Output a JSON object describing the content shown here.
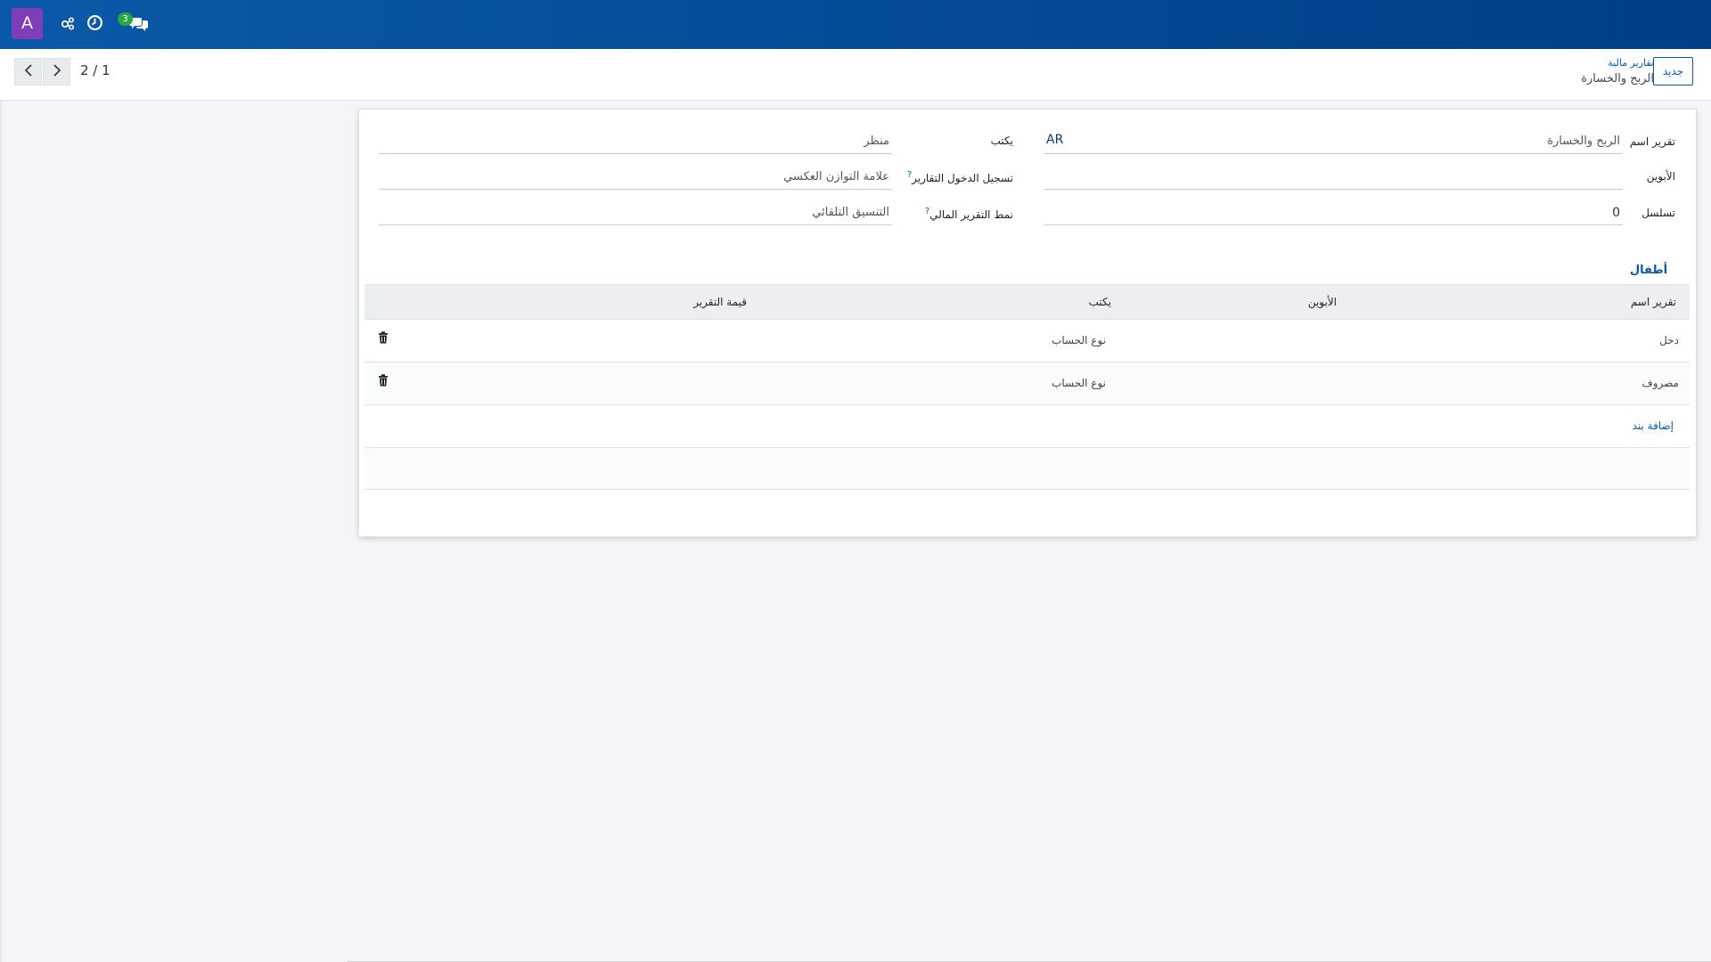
{
  "topbar": {
    "avatar_letter": "A",
    "icons": [
      "settings-share-icon",
      "clock-icon",
      "chat-icon"
    ],
    "chat_badge": "3",
    "bg_colors": [
      "#0a59a8",
      "#003f86"
    ],
    "avatar_color": "#7f3db7",
    "badge_color": "#28a745"
  },
  "control": {
    "pager": "2 / 1",
    "new_button": "جديد",
    "breadcrumb_parent": "تقارير مالية",
    "breadcrumb_current": "الربح والخسارة"
  },
  "form": {
    "report_name_label": "تقرير اسم",
    "report_name_value": "الربح والخسارة",
    "report_name_lang": "AR",
    "parents_label": "الأبوين",
    "parents_value": "",
    "sequence_label": "تسلسل",
    "sequence_value": "0",
    "type_label": "يكتب",
    "type_value": "منظر",
    "report_entry_label": "تسجيل الدخول التقارير",
    "report_entry_help": "?",
    "report_entry_value": "علامة التوازن العكسي",
    "report_style_label": "نمط التقرير المالي",
    "report_style_help": "?",
    "report_style_value": "التنسيق التلقائي"
  },
  "tabs": {
    "children_label": "أطفال"
  },
  "table": {
    "headers": {
      "name": "تقرير اسم",
      "parents": "الأبوين",
      "type": "يكتب",
      "report_value": "قيمة التقرير"
    },
    "rows": [
      {
        "name": "دخل",
        "parents": "",
        "type": "نوع الحساب",
        "report_value": ""
      },
      {
        "name": "مصروف",
        "parents": "",
        "type": "نوع الحساب",
        "report_value": ""
      }
    ],
    "add_line": "إضافة بند"
  }
}
